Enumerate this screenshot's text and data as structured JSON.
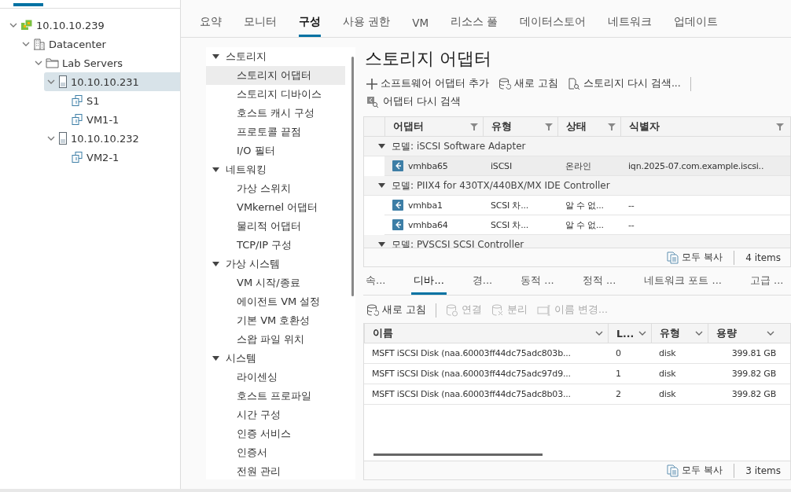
{
  "tree": [
    {
      "label": "10.10.10.239",
      "kind": "vcenter",
      "expanded": true,
      "selected": false,
      "children": [
        {
          "label": "Datacenter",
          "kind": "datacenter",
          "expanded": true,
          "selected": false,
          "children": [
            {
              "label": "Lab Servers",
              "kind": "folder",
              "expanded": true,
              "selected": false,
              "children": [
                {
                  "label": "10.10.10.231",
                  "kind": "host",
                  "expanded": true,
                  "selected": true,
                  "children": [
                    {
                      "label": "S1",
                      "kind": "vm",
                      "selected": false
                    },
                    {
                      "label": "VM1-1",
                      "kind": "vm",
                      "selected": false
                    }
                  ]
                },
                {
                  "label": "10.10.10.232",
                  "kind": "host",
                  "expanded": true,
                  "selected": false,
                  "children": [
                    {
                      "label": "VM2-1",
                      "kind": "vm",
                      "selected": false
                    }
                  ]
                }
              ]
            }
          ]
        }
      ]
    }
  ],
  "tabs": [
    {
      "label": "요약",
      "selected": false
    },
    {
      "label": "모니터",
      "selected": false
    },
    {
      "label": "구성",
      "selected": true
    },
    {
      "label": "사용 권한",
      "selected": false
    },
    {
      "label": "VM",
      "selected": false
    },
    {
      "label": "리소스 풀",
      "selected": false
    },
    {
      "label": "데이터스토어",
      "selected": false
    },
    {
      "label": "네트워크",
      "selected": false
    },
    {
      "label": "업데이트",
      "selected": false
    }
  ],
  "config_nav": [
    {
      "label": "스토리지",
      "expanded": true,
      "items": [
        {
          "label": "스토리지 어댑터",
          "selected": true
        },
        {
          "label": "스토리지 디바이스",
          "selected": false
        },
        {
          "label": "호스트 캐시 구성",
          "selected": false
        },
        {
          "label": "프로토콜 끝점",
          "selected": false
        },
        {
          "label": "I/O 필터",
          "selected": false
        }
      ]
    },
    {
      "label": "네트워킹",
      "expanded": true,
      "items": [
        {
          "label": "가상 스위치",
          "selected": false
        },
        {
          "label": "VMkernel 어댑터",
          "selected": false
        },
        {
          "label": "물리적 어댑터",
          "selected": false
        },
        {
          "label": "TCP/IP 구성",
          "selected": false
        }
      ]
    },
    {
      "label": "가상 시스템",
      "expanded": true,
      "items": [
        {
          "label": "VM 시작/종료",
          "selected": false
        },
        {
          "label": "에이전트 VM 설정",
          "selected": false
        },
        {
          "label": "기본 VM 호환성",
          "selected": false
        },
        {
          "label": "스왑 파일 위치",
          "selected": false
        }
      ]
    },
    {
      "label": "시스템",
      "expanded": true,
      "items": [
        {
          "label": "라이센싱",
          "selected": false
        },
        {
          "label": "호스트 프로파일",
          "selected": false
        },
        {
          "label": "시간 구성",
          "selected": false
        },
        {
          "label": "인증 서비스",
          "selected": false
        },
        {
          "label": "인증서",
          "selected": false
        },
        {
          "label": "전원 관리",
          "selected": false
        }
      ]
    }
  ],
  "adapters": {
    "title": "스토리지 어댑터",
    "toolbar": [
      {
        "label": "소프트웨어 어댑터 추가",
        "kind": "add"
      },
      {
        "label": "새로 고침",
        "kind": "refresh"
      },
      {
        "label": "스토리지 다시 검색...",
        "kind": "rescan-storage"
      },
      {
        "label": "어댑터 다시 검색",
        "kind": "rescan-adapter"
      }
    ],
    "columns": [
      "어댑터",
      "유형",
      "상태",
      "식별자"
    ],
    "groups": [
      {
        "prefix": "모델:",
        "label": "iSCSI Software Adapter",
        "expanded": true,
        "rows": [
          {
            "cells": [
              "vmhba65",
              "iSCSI",
              "온라인",
              "iqn.2025-07.com.example.iscsi.."
            ],
            "selected": true
          }
        ]
      },
      {
        "prefix": "모델:",
        "label": "PIIX4 for 430TX/440BX/MX IDE Controller",
        "expanded": true,
        "rows": [
          {
            "cells": [
              "vmhba1",
              "SCSI 차...",
              "알 수 없...",
              "--"
            ],
            "selected": false
          },
          {
            "cells": [
              "vmhba64",
              "SCSI 차...",
              "알 수 없...",
              "--"
            ],
            "selected": false
          }
        ]
      },
      {
        "prefix": "모델:",
        "label": "PVSCSI SCSI Controller",
        "expanded": true
      }
    ],
    "copy_all": "모두 복사",
    "count": "4 items"
  },
  "details": {
    "tabs": [
      {
        "label": "속...",
        "selected": false
      },
      {
        "label": "디바...",
        "selected": true
      },
      {
        "label": "경...",
        "selected": false
      },
      {
        "label": "동적 ...",
        "selected": false
      },
      {
        "label": "정적 ...",
        "selected": false
      },
      {
        "label": "네트워크 포트 ...",
        "selected": false
      },
      {
        "label": "고급 ...",
        "selected": false
      }
    ],
    "toolbar": [
      {
        "label": "새로 고침",
        "kind": "refresh",
        "disabled": false
      },
      {
        "label": "연결",
        "kind": "attach",
        "disabled": true
      },
      {
        "label": "분리",
        "kind": "detach",
        "disabled": true
      },
      {
        "label": "이름 변경...",
        "kind": "rename",
        "disabled": true
      }
    ],
    "columns": [
      "이름",
      "L...",
      "유형",
      "용량"
    ],
    "rows": [
      [
        "MSFT iSCSI Disk (naa.60003ff44dc75adc803b...",
        "0",
        "disk",
        "399.81 GB"
      ],
      [
        "MSFT iSCSI Disk (naa.60003ff44dc75adc97d9...",
        "1",
        "disk",
        "399.82 GB"
      ],
      [
        "MSFT iSCSI Disk (naa.60003ff44dc75adc8b03...",
        "2",
        "disk",
        "399.82 GB"
      ]
    ],
    "copy_all": "모두 복사",
    "count": "3 items"
  }
}
